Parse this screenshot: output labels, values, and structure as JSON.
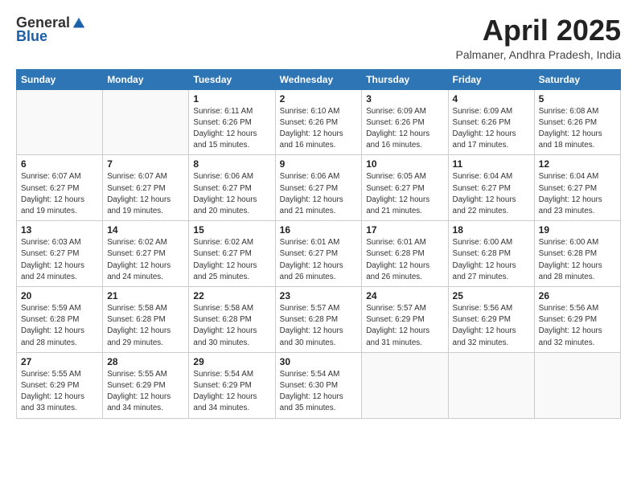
{
  "header": {
    "logo_general": "General",
    "logo_blue": "Blue",
    "title": "April 2025",
    "location": "Palmaner, Andhra Pradesh, India"
  },
  "weekdays": [
    "Sunday",
    "Monday",
    "Tuesday",
    "Wednesday",
    "Thursday",
    "Friday",
    "Saturday"
  ],
  "weeks": [
    [
      {
        "day": "",
        "info": ""
      },
      {
        "day": "",
        "info": ""
      },
      {
        "day": "1",
        "info": "Sunrise: 6:11 AM\nSunset: 6:26 PM\nDaylight: 12 hours\nand 15 minutes."
      },
      {
        "day": "2",
        "info": "Sunrise: 6:10 AM\nSunset: 6:26 PM\nDaylight: 12 hours\nand 16 minutes."
      },
      {
        "day": "3",
        "info": "Sunrise: 6:09 AM\nSunset: 6:26 PM\nDaylight: 12 hours\nand 16 minutes."
      },
      {
        "day": "4",
        "info": "Sunrise: 6:09 AM\nSunset: 6:26 PM\nDaylight: 12 hours\nand 17 minutes."
      },
      {
        "day": "5",
        "info": "Sunrise: 6:08 AM\nSunset: 6:26 PM\nDaylight: 12 hours\nand 18 minutes."
      }
    ],
    [
      {
        "day": "6",
        "info": "Sunrise: 6:07 AM\nSunset: 6:27 PM\nDaylight: 12 hours\nand 19 minutes."
      },
      {
        "day": "7",
        "info": "Sunrise: 6:07 AM\nSunset: 6:27 PM\nDaylight: 12 hours\nand 19 minutes."
      },
      {
        "day": "8",
        "info": "Sunrise: 6:06 AM\nSunset: 6:27 PM\nDaylight: 12 hours\nand 20 minutes."
      },
      {
        "day": "9",
        "info": "Sunrise: 6:06 AM\nSunset: 6:27 PM\nDaylight: 12 hours\nand 21 minutes."
      },
      {
        "day": "10",
        "info": "Sunrise: 6:05 AM\nSunset: 6:27 PM\nDaylight: 12 hours\nand 21 minutes."
      },
      {
        "day": "11",
        "info": "Sunrise: 6:04 AM\nSunset: 6:27 PM\nDaylight: 12 hours\nand 22 minutes."
      },
      {
        "day": "12",
        "info": "Sunrise: 6:04 AM\nSunset: 6:27 PM\nDaylight: 12 hours\nand 23 minutes."
      }
    ],
    [
      {
        "day": "13",
        "info": "Sunrise: 6:03 AM\nSunset: 6:27 PM\nDaylight: 12 hours\nand 24 minutes."
      },
      {
        "day": "14",
        "info": "Sunrise: 6:02 AM\nSunset: 6:27 PM\nDaylight: 12 hours\nand 24 minutes."
      },
      {
        "day": "15",
        "info": "Sunrise: 6:02 AM\nSunset: 6:27 PM\nDaylight: 12 hours\nand 25 minutes."
      },
      {
        "day": "16",
        "info": "Sunrise: 6:01 AM\nSunset: 6:27 PM\nDaylight: 12 hours\nand 26 minutes."
      },
      {
        "day": "17",
        "info": "Sunrise: 6:01 AM\nSunset: 6:28 PM\nDaylight: 12 hours\nand 26 minutes."
      },
      {
        "day": "18",
        "info": "Sunrise: 6:00 AM\nSunset: 6:28 PM\nDaylight: 12 hours\nand 27 minutes."
      },
      {
        "day": "19",
        "info": "Sunrise: 6:00 AM\nSunset: 6:28 PM\nDaylight: 12 hours\nand 28 minutes."
      }
    ],
    [
      {
        "day": "20",
        "info": "Sunrise: 5:59 AM\nSunset: 6:28 PM\nDaylight: 12 hours\nand 28 minutes."
      },
      {
        "day": "21",
        "info": "Sunrise: 5:58 AM\nSunset: 6:28 PM\nDaylight: 12 hours\nand 29 minutes."
      },
      {
        "day": "22",
        "info": "Sunrise: 5:58 AM\nSunset: 6:28 PM\nDaylight: 12 hours\nand 30 minutes."
      },
      {
        "day": "23",
        "info": "Sunrise: 5:57 AM\nSunset: 6:28 PM\nDaylight: 12 hours\nand 30 minutes."
      },
      {
        "day": "24",
        "info": "Sunrise: 5:57 AM\nSunset: 6:29 PM\nDaylight: 12 hours\nand 31 minutes."
      },
      {
        "day": "25",
        "info": "Sunrise: 5:56 AM\nSunset: 6:29 PM\nDaylight: 12 hours\nand 32 minutes."
      },
      {
        "day": "26",
        "info": "Sunrise: 5:56 AM\nSunset: 6:29 PM\nDaylight: 12 hours\nand 32 minutes."
      }
    ],
    [
      {
        "day": "27",
        "info": "Sunrise: 5:55 AM\nSunset: 6:29 PM\nDaylight: 12 hours\nand 33 minutes."
      },
      {
        "day": "28",
        "info": "Sunrise: 5:55 AM\nSunset: 6:29 PM\nDaylight: 12 hours\nand 34 minutes."
      },
      {
        "day": "29",
        "info": "Sunrise: 5:54 AM\nSunset: 6:29 PM\nDaylight: 12 hours\nand 34 minutes."
      },
      {
        "day": "30",
        "info": "Sunrise: 5:54 AM\nSunset: 6:30 PM\nDaylight: 12 hours\nand 35 minutes."
      },
      {
        "day": "",
        "info": ""
      },
      {
        "day": "",
        "info": ""
      },
      {
        "day": "",
        "info": ""
      }
    ]
  ]
}
